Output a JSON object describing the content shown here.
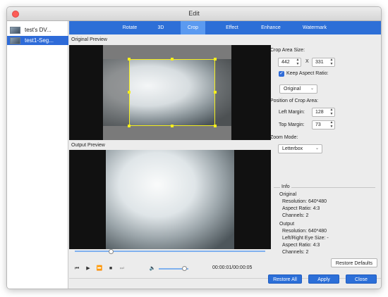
{
  "window": {
    "title": "Edit"
  },
  "sidebar": {
    "items": [
      {
        "label": "test's DV...",
        "selected": false
      },
      {
        "label": "test1-Seg...",
        "selected": true
      }
    ]
  },
  "tabs": [
    {
      "label": "Rotate",
      "active": false
    },
    {
      "label": "3D",
      "active": false
    },
    {
      "label": "Crop",
      "active": true
    },
    {
      "label": "Effect",
      "active": false
    },
    {
      "label": "Enhance",
      "active": false
    },
    {
      "label": "Watermark",
      "active": false
    }
  ],
  "preview": {
    "original_label": "Original Preview",
    "output_label": "Output Preview"
  },
  "playback": {
    "time": "00:00:01/00:00:05",
    "progress": 0.19,
    "volume": 0.85
  },
  "crop": {
    "area_size_label": "Crop Area Size:",
    "width": "442",
    "x_label": "X",
    "height": "331",
    "keep_aspect_label": "Keep Aspect Ratio:",
    "keep_aspect_checked": true,
    "aspect_value": "Original",
    "position_label": "Position of Crop Area:",
    "left_margin_label": "Left Margin:",
    "left_margin": "128",
    "top_margin_label": "Top Margin:",
    "top_margin": "73",
    "zoom_label": "Zoom Mode:",
    "zoom_value": "Letterbox"
  },
  "info": {
    "header": "Info",
    "original_header": "Original",
    "original_resolution": "Resolution: 640*480",
    "original_aspect": "Aspect Ratio: 4:3",
    "original_channels": "Channels: 2",
    "output_header": "Output",
    "output_resolution": "Resolution: 640*480",
    "output_eye_size": "Left/Right Eye Size: -",
    "output_aspect": "Aspect Ratio: 4:3",
    "output_channels": "Channels: 2"
  },
  "buttons": {
    "restore_defaults": "Restore Defaults",
    "restore_all": "Restore All",
    "apply": "Apply",
    "close": "Close"
  },
  "colors": {
    "accent": "#2d6fd7",
    "active_tab": "#5b9af0",
    "crop_border": "#f4ee1e"
  }
}
